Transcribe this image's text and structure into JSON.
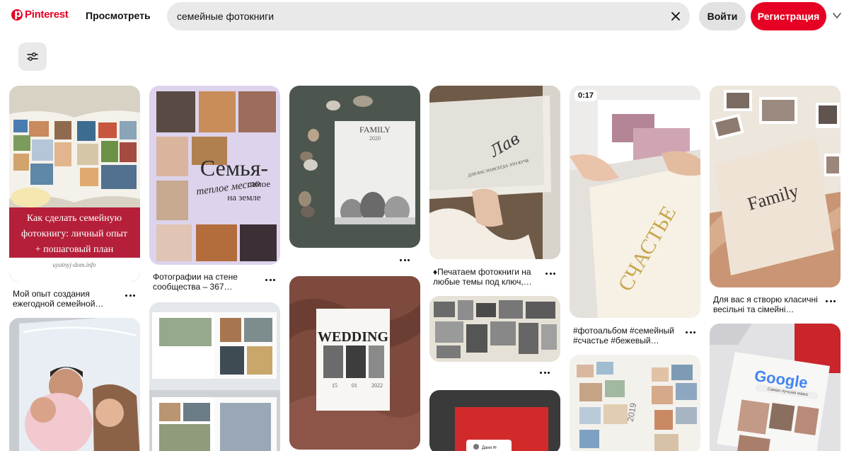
{
  "header": {
    "logo_text": "Pinterest",
    "browse_label": "Просмотреть",
    "search_value": "семейные фотокниги",
    "login_label": "Войти",
    "signup_label": "Регистрация"
  },
  "pins": {
    "p1": {
      "title_lines": [
        "Как сделать семейную",
        "фотокнигу: личный опыт",
        "+ пошаговый план"
      ],
      "site": "uyutnyj-dom.info",
      "caption_1": "Мой опыт создания",
      "caption_2": "ежегодной семейной…"
    },
    "p3": {
      "heading_1": "Семья-",
      "heading_2": "самое",
      "heading_3": "теплое место",
      "heading_4": "на земле",
      "caption_1": "Фотографии на стене",
      "caption_2": "сообщества – 367…"
    },
    "p5": {
      "book_title": "FAMILY",
      "book_year": "2020"
    },
    "p6": {
      "book_title": "WEDDING",
      "date_d": "15",
      "date_m": "01",
      "date_y": "2022"
    },
    "p7": {
      "script_text": "Лав",
      "sub_text": "ДЛЯ ВАС НАВСЕГДА ЭТО КУЧЕ",
      "caption_1": "♦Печатаем фотокниги на",
      "caption_2": "любые темы под ключ,…"
    },
    "p9": {
      "dm_name": "Даня ✉"
    },
    "p10": {
      "badge": "0:17",
      "cover_text": "СЧАСТЬЕ",
      "caption_1": "#фотоальбом #семейный",
      "caption_2": "#счастье #бежевый…"
    },
    "p11": {
      "year": "2019"
    },
    "p12": {
      "cover_text": "Family",
      "caption_1": "Для вас я створю класичні",
      "caption_2": "весільні та сімейні…"
    },
    "p13": {
      "brand": "Google",
      "search_text": "Самая лучшая мама"
    }
  }
}
